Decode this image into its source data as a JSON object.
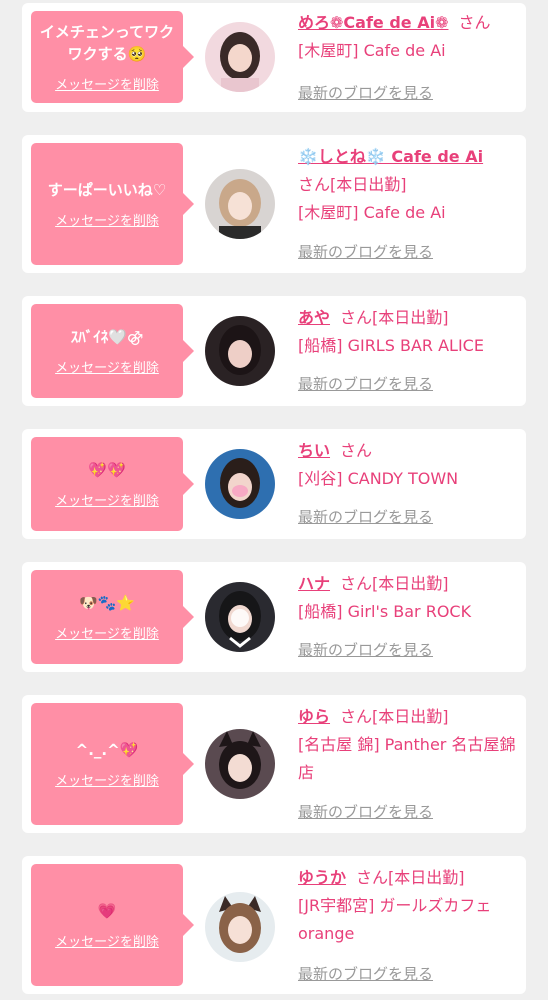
{
  "items": [
    {
      "message": "イメチェンってワクワクする🥺",
      "delete_label": "メッセージを削除",
      "name": "めろ❁Cafe de Ai❁",
      "san": "さん",
      "status": "",
      "shop": "[木屋町] Cafe de Ai",
      "blog_label": "最新のブログを見る",
      "avatar_bg": "#f2d9df",
      "avatar_hair": "#3a2a28"
    },
    {
      "message": "すーぱーいいね♡",
      "delete_label": "メッセージを削除",
      "name": "❄️しとね❄️ Cafe de Ai",
      "san": "さん",
      "status": "[本日出勤]",
      "shop": "[木屋町] Cafe de Ai",
      "blog_label": "最新のブログを見る",
      "avatar_bg": "#d8d4d2",
      "avatar_hair": "#c9a88a"
    },
    {
      "message": "ｽﾊﾞｲﾈ🤍⚣",
      "delete_label": "メッセージを削除",
      "name": "あや",
      "san": "さん",
      "status": "[本日出勤]",
      "shop": "[船橋] GIRLS BAR ALICE",
      "blog_label": "最新のブログを見る",
      "avatar_bg": "#2a2224",
      "avatar_hair": "#1c1416"
    },
    {
      "message": "💖💖",
      "delete_label": "メッセージを削除",
      "name": "ちい",
      "san": "さん",
      "status": "",
      "shop": "[刈谷] CANDY TOWN",
      "blog_label": "最新のブログを見る",
      "avatar_bg": "#2e6fb0",
      "avatar_hair": "#2a1e1a"
    },
    {
      "message": "🐶🐾⭐",
      "delete_label": "メッセージを削除",
      "name": "ハナ",
      "san": "さん",
      "status": "[本日出勤]",
      "shop": "[船橋] Girl's Bar ROCK",
      "blog_label": "最新のブログを見る",
      "avatar_bg": "#2a2a30",
      "avatar_hair": "#161618"
    },
    {
      "message": "^._.^💖",
      "delete_label": "メッセージを削除",
      "name": "ゆら",
      "san": "さん",
      "status": "[本日出勤]",
      "shop": "[名古屋 錦] Panther 名古屋錦店",
      "blog_label": "最新のブログを見る",
      "avatar_bg": "#5a4a50",
      "avatar_hair": "#1e1618"
    },
    {
      "message": "💗",
      "delete_label": "メッセージを削除",
      "name": "ゆうか",
      "san": "さん",
      "status": "[本日出勤]",
      "shop": "[JR宇都宮] ガールズカフェ orange",
      "blog_label": "最新のブログを見る",
      "avatar_bg": "#e6ecef",
      "avatar_hair": "#8a6248"
    }
  ]
}
